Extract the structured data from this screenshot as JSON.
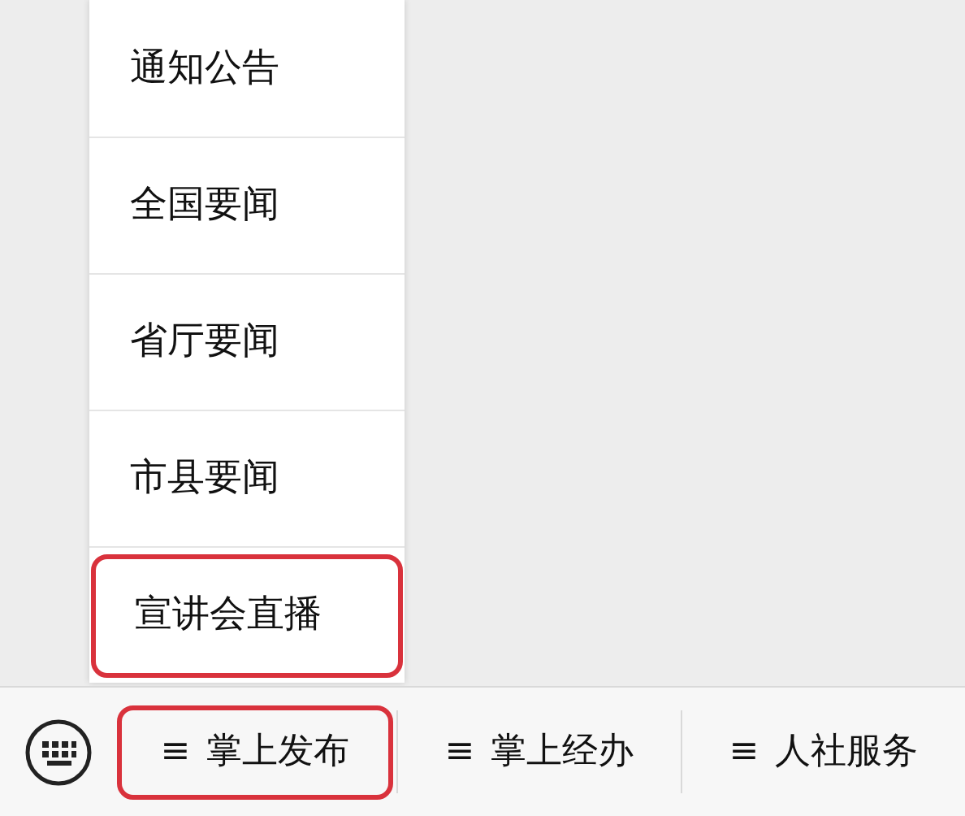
{
  "menu": {
    "items": [
      {
        "label": "通知公告",
        "highlighted": false
      },
      {
        "label": "全国要闻",
        "highlighted": false
      },
      {
        "label": "省厅要闻",
        "highlighted": false
      },
      {
        "label": "市县要闻",
        "highlighted": false
      },
      {
        "label": "宣讲会直播",
        "highlighted": true
      }
    ]
  },
  "bottom_bar": {
    "tabs": [
      {
        "glyph": "≡",
        "label": "掌上发布",
        "highlighted": true
      },
      {
        "glyph": "≡",
        "label": "掌上经办",
        "highlighted": false
      },
      {
        "glyph": "≡",
        "label": "人社服务",
        "highlighted": false
      }
    ]
  }
}
